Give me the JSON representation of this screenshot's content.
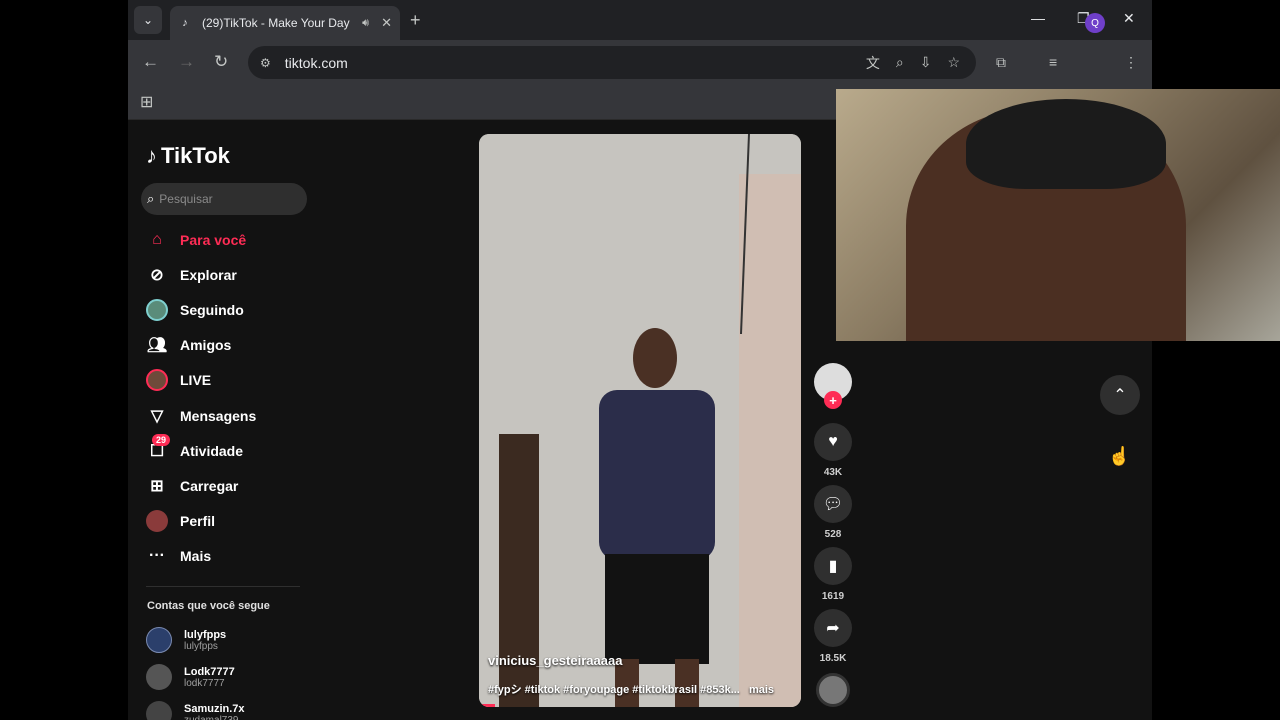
{
  "browser": {
    "tab_title": "(29)TikTok - Make Your Day",
    "url": "tiktok.com",
    "profile_initial": "Q"
  },
  "tiktok": {
    "logo": "TikTok",
    "search_placeholder": "Pesquisar",
    "nav": [
      {
        "label": "Para você",
        "icon": "home-icon",
        "active": true
      },
      {
        "label": "Explorar",
        "icon": "compass-icon"
      },
      {
        "label": "Seguindo",
        "icon": "following-avatar"
      },
      {
        "label": "Amigos",
        "icon": "friends-icon"
      },
      {
        "label": "LIVE",
        "icon": "live-avatar"
      },
      {
        "label": "Mensagens",
        "icon": "messages-icon"
      },
      {
        "label": "Atividade",
        "icon": "activity-icon",
        "badge": "29"
      },
      {
        "label": "Carregar",
        "icon": "upload-icon"
      },
      {
        "label": "Perfil",
        "icon": "profile-avatar"
      },
      {
        "label": "Mais",
        "icon": "more-icon"
      }
    ],
    "following_header": "Contas que você segue",
    "accounts": [
      {
        "name": "lulyfpps",
        "handle": "lulyfpps"
      },
      {
        "name": "Lodk7777",
        "handle": "lodk7777"
      },
      {
        "name": "Samuzin.7x",
        "handle": "zudamal739"
      }
    ],
    "video": {
      "author": "vinicius_gesteiraaaaa",
      "description": "#fypシ #tiktok #foryoupage #tiktokbrasil #853k...",
      "more": "mais",
      "progress": 0.05
    },
    "actions": {
      "likes": "43K",
      "comments": "528",
      "saves": "1619",
      "shares": "18.5K"
    }
  }
}
